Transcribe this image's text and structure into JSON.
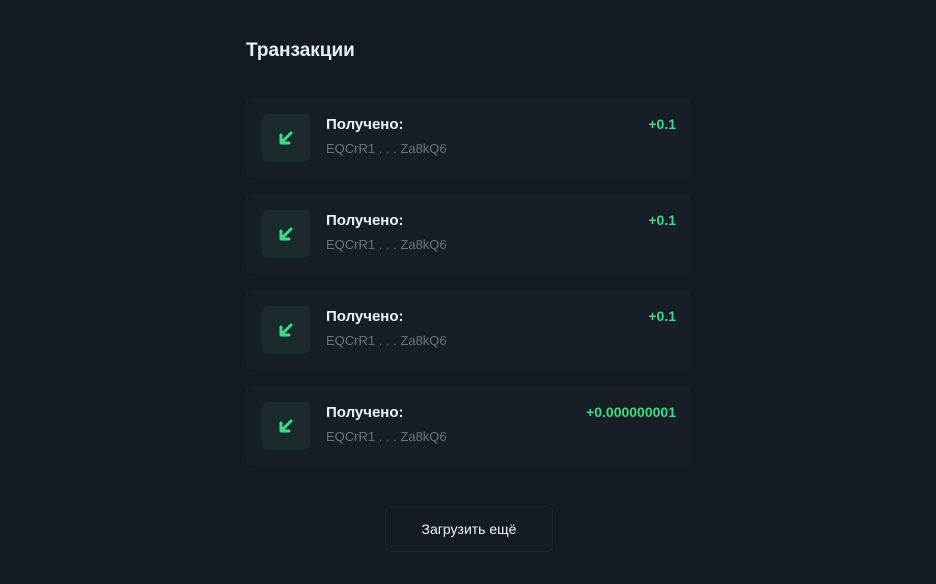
{
  "page": {
    "title": "Транзакции"
  },
  "transactions": [
    {
      "label": "Получено:",
      "address": "EQCrR1 . . . Za8kQ6",
      "amount": "+0.1",
      "icon": "arrow-down-left-icon"
    },
    {
      "label": "Получено:",
      "address": "EQCrR1 . . . Za8kQ6",
      "amount": "+0.1",
      "icon": "arrow-down-left-icon"
    },
    {
      "label": "Получено:",
      "address": "EQCrR1 . . . Za8kQ6",
      "amount": "+0.1",
      "icon": "arrow-down-left-icon"
    },
    {
      "label": "Получено:",
      "address": "EQCrR1 . . . Za8kQ6",
      "amount": "+0.000000001",
      "icon": "arrow-down-left-icon"
    }
  ],
  "load_more": {
    "label": "Загрузить ещё"
  },
  "colors": {
    "background": "#131a22",
    "card": "#171e25",
    "icon_bg": "#1b2a2a",
    "accent_green": "#3ddc84",
    "muted_text": "#69737f"
  }
}
